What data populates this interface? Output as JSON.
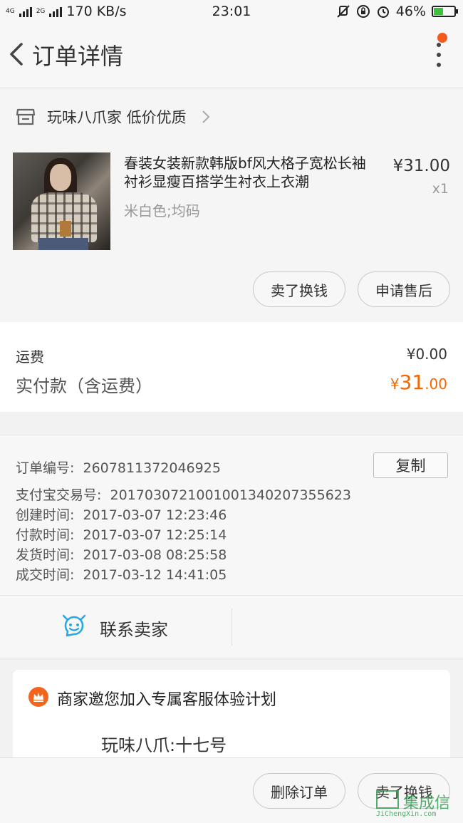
{
  "status_bar": {
    "net_left": "4G",
    "net_right": "2G",
    "speed": "170 KB/s",
    "time": "23:01",
    "battery": "46%",
    "battery_level": 0.46
  },
  "nav": {
    "title": "订单详情",
    "has_notification": true
  },
  "shop": {
    "name": "玩味八爪家 低价优质"
  },
  "item": {
    "title": "春装女装新款韩版bf风大格子宽松长袖衬衫显瘦百搭学生衬衣上衣潮",
    "sku": "米白色;均码",
    "price": "¥31.00",
    "qty": "x1",
    "sell_label": "卖了换钱",
    "after_sale_label": "申请售后"
  },
  "fees": {
    "shipping_label": "运费",
    "shipping_value": "¥0.00",
    "paid_label": "实付款（含运费）",
    "paid_currency": "¥",
    "paid_integer": "31",
    "paid_decimal": ".00",
    "accent_color": "#f56700"
  },
  "order_info": {
    "order_no_label": "订单编号:",
    "order_no": "2607811372046925",
    "copy_label": "复制",
    "alipay_label": "支付宝交易号:",
    "alipay_no": "2017030721001001340207355623",
    "created_label": "创建时间:",
    "created": "2017-03-07 12:23:46",
    "paid_label": "付款时间:",
    "paid": "2017-03-07 12:25:14",
    "shipped_label": "发货时间:",
    "shipped": "2017-03-08 08:25:58",
    "done_label": "成交时间:",
    "done": "2017-03-12 14:41:05"
  },
  "contact": {
    "label": "联系卖家",
    "icon": "chat-smile-icon"
  },
  "promo": {
    "heading": "商家邀您加入专属客服体验计划",
    "shop_name": "玩味八爪:十七号",
    "icon": "crown-icon"
  },
  "bottom": {
    "delete_label": "删除订单",
    "sell_label": "卖了换钱"
  },
  "watermark": {
    "text": "集成信",
    "url": "JiChengXin.com"
  }
}
